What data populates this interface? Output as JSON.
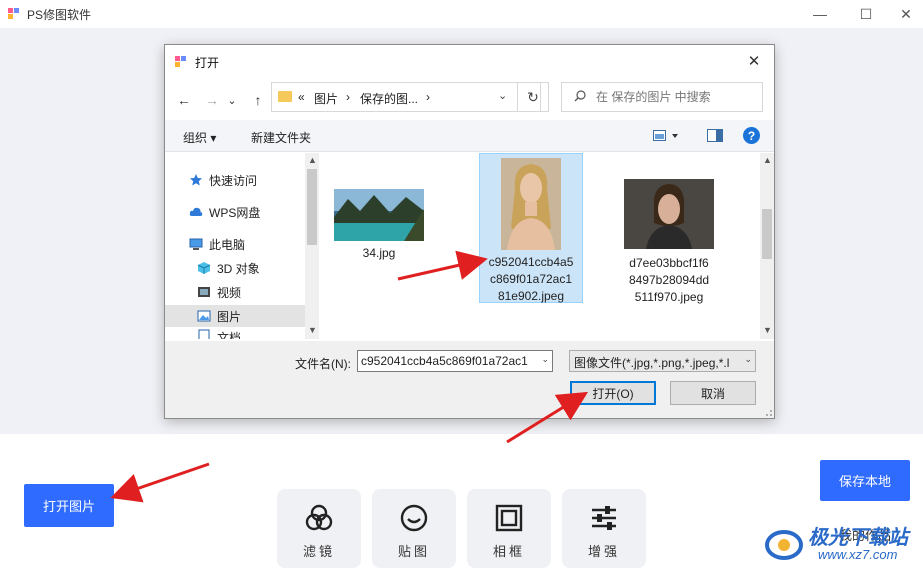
{
  "app": {
    "title": "PS修图软件",
    "window_controls": [
      "—",
      "☐",
      "✕"
    ]
  },
  "dialog": {
    "title": "打开",
    "close_glyph": "✕",
    "nav": {
      "back": "←",
      "forward": "→",
      "recent": "⌄",
      "up": "↑"
    },
    "breadcrumb": [
      "«",
      "图片",
      "›",
      "保存的图...",
      "›"
    ],
    "refresh_glyph": "↻",
    "search_placeholder": "在 保存的图片 中搜索",
    "toolbar": {
      "organize": "组织 ▾",
      "new_folder": "新建文件夹",
      "help": "?"
    },
    "nav_pane": [
      {
        "label": "快速访问",
        "icon": "star-icon"
      },
      {
        "label": "WPS网盘",
        "icon": "cloud-icon"
      },
      {
        "label": "此电脑",
        "icon": "computer-icon"
      },
      {
        "label": "3D 对象",
        "icon": "cube-icon"
      },
      {
        "label": "视频",
        "icon": "video-icon"
      },
      {
        "label": "图片",
        "icon": "pictures-icon",
        "selected": true
      },
      {
        "label": "文档",
        "icon": "document-icon"
      }
    ],
    "files": [
      {
        "name": "34.jpg",
        "thumb": "landscape-thumbnail"
      },
      {
        "name": "c952041ccb4a5\nc869f01a72ac1\n81e902.jpeg",
        "thumb": "portrait-blonde-thumbnail",
        "selected": true
      },
      {
        "name": "d7ee03bbcf1f6\n8497b28094dd\n511f970.jpeg",
        "thumb": "portrait-dark-thumbnail"
      }
    ],
    "filename_label": "文件名(N):",
    "filename_value": "c952041ccb4a5c869f01a72ac1",
    "filetype_value": "图像文件(*.jpg,*.png,*.jpeg,*.l",
    "open_button": "打开(O)",
    "cancel_button": "取消"
  },
  "bottom": {
    "open_image": "打开图片",
    "save_local": "保存本地",
    "back_works": "我的作品",
    "tools": [
      {
        "label": "滤镜",
        "icon": "filter-icon"
      },
      {
        "label": "贴图",
        "icon": "sticker-icon"
      },
      {
        "label": "相框",
        "icon": "frame-icon"
      },
      {
        "label": "增强",
        "icon": "enhance-icon"
      }
    ]
  },
  "watermark": {
    "text": "极光下载站",
    "url": "www.xz7.com"
  },
  "colors": {
    "accent": "#2f6bff",
    "annotation": "#e02020",
    "selection": "#cce4f7"
  }
}
